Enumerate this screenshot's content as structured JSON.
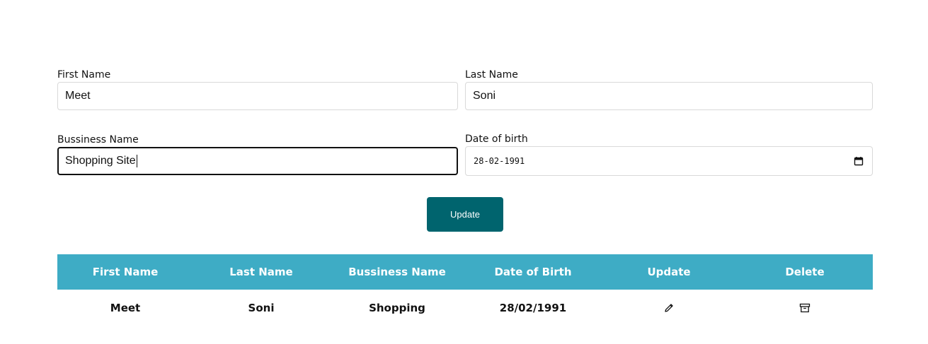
{
  "form": {
    "first_name": {
      "label": "First Name",
      "value": "Meet"
    },
    "last_name": {
      "label": "Last Name",
      "value": "Soni"
    },
    "business_name": {
      "label": "Bussiness Name",
      "value": "Shopping Site"
    },
    "date_of_birth": {
      "label": "Date of birth",
      "value": "28-02-1991",
      "icon": "calendar-icon"
    },
    "submit_label": "Update"
  },
  "table": {
    "header_color": "#3eacc5",
    "columns": [
      "First Name",
      "Last Name",
      "Bussiness Name",
      "Date of Birth",
      "Update",
      "Delete"
    ],
    "rows": [
      {
        "first_name": "Meet",
        "last_name": "Soni",
        "business_name": "Shopping",
        "date_of_birth": "28/02/1991",
        "update_icon": "pencil-icon",
        "delete_icon": "archive-icon"
      }
    ]
  },
  "colors": {
    "button": "#00646e",
    "header": "#3eacc5"
  }
}
